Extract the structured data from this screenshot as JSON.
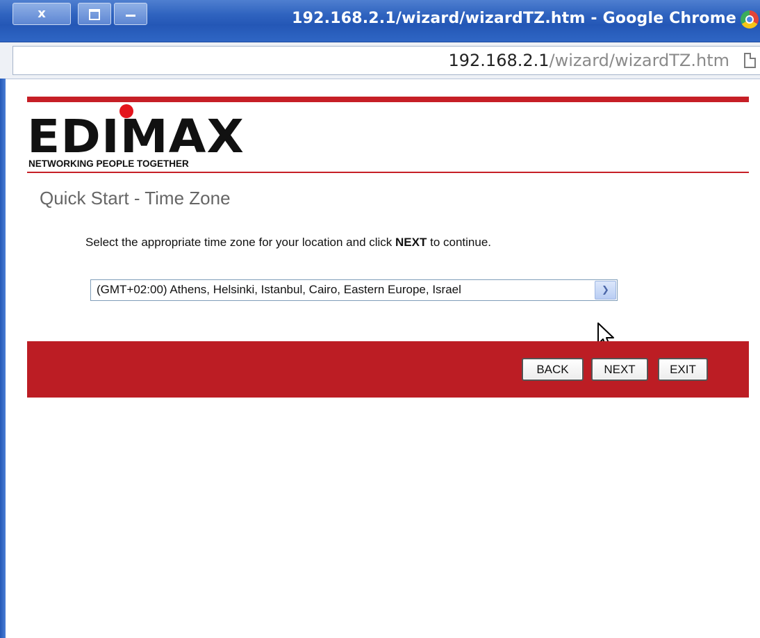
{
  "window": {
    "title": "192.168.2.1/wizard/wizardTZ.htm - Google Chrome",
    "close_glyph": "x",
    "icon": "chrome-icon"
  },
  "address_bar": {
    "host": "192.168.2.1",
    "path": "/wizard/wizardTZ.htm",
    "icon": "page-icon"
  },
  "logo": {
    "wordmark": "EDIMAX",
    "tagline": "NETWORKING PEOPLE TOGETHER",
    "dot_color": "#e4141c"
  },
  "page": {
    "title": "Quick Start - Time Zone",
    "instruction_before": "Select the appropriate time zone for your location and click ",
    "instruction_bold": "NEXT",
    "instruction_after": " to continue."
  },
  "timezone_select": {
    "selected": "(GMT+02:00) Athens, Helsinki, Istanbul, Cairo, Eastern Europe, Israel"
  },
  "buttons": {
    "back": "BACK",
    "next": "NEXT",
    "exit": "EXIT"
  },
  "colors": {
    "brand_red": "#c61f26",
    "footer_red": "#bc1d24",
    "titlebar_blue": "#2457b6"
  }
}
